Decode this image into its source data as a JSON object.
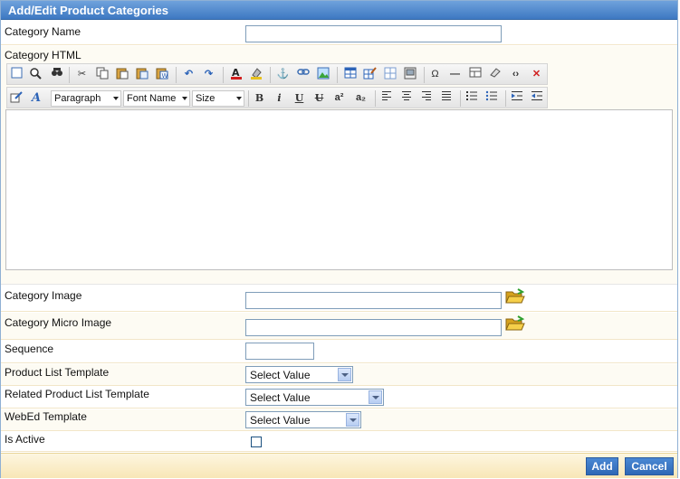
{
  "title": "Add/Edit Product Categories",
  "fields": {
    "category_name": {
      "label": "Category Name",
      "value": ""
    },
    "category_html": {
      "label": "Category HTML"
    },
    "category_image": {
      "label": "Category Image",
      "value": ""
    },
    "category_micro_image": {
      "label": "Category Micro Image",
      "value": ""
    },
    "sequence": {
      "label": "Sequence",
      "value": ""
    },
    "product_list_template": {
      "label": "Product List Template",
      "selected": "Select Value"
    },
    "related_product_list_template": {
      "label": "Related Product List Template",
      "selected": "Select Value"
    },
    "webed_template": {
      "label": "WebEd Template",
      "selected": "Select Value"
    },
    "is_active": {
      "label": "Is Active",
      "checked": false
    }
  },
  "editor": {
    "format_dropdown": "Paragraph",
    "font_dropdown": "Font Name",
    "size_dropdown": "Size",
    "toolbar_row1_icons": [
      "source-icon",
      "preview-icon",
      "find-icon",
      "cut-icon",
      "copy-icon",
      "paste-icon",
      "paste-text-icon",
      "paste-word-icon",
      "undo-icon",
      "redo-icon",
      "text-color-icon",
      "bg-color-icon",
      "anchor-icon",
      "link-icon",
      "image-icon",
      "table-icon",
      "table-edit-icon",
      "cells-icon",
      "frame-icon",
      "special-char-icon",
      "horizontal-rule-icon",
      "layer-icon",
      "eraser-icon",
      "code-icon",
      "delete-icon"
    ],
    "toolbar_row2_glyphs": {
      "bold": "B",
      "italic": "i",
      "underline": "U",
      "strike": "U",
      "superscript": "a²",
      "subscript": "a₂"
    }
  },
  "buttons": {
    "add": "Add",
    "cancel": "Cancel"
  },
  "colors": {
    "accent": "#3d78c2",
    "footer": "#f8e6b6",
    "delete": "#d02020"
  }
}
